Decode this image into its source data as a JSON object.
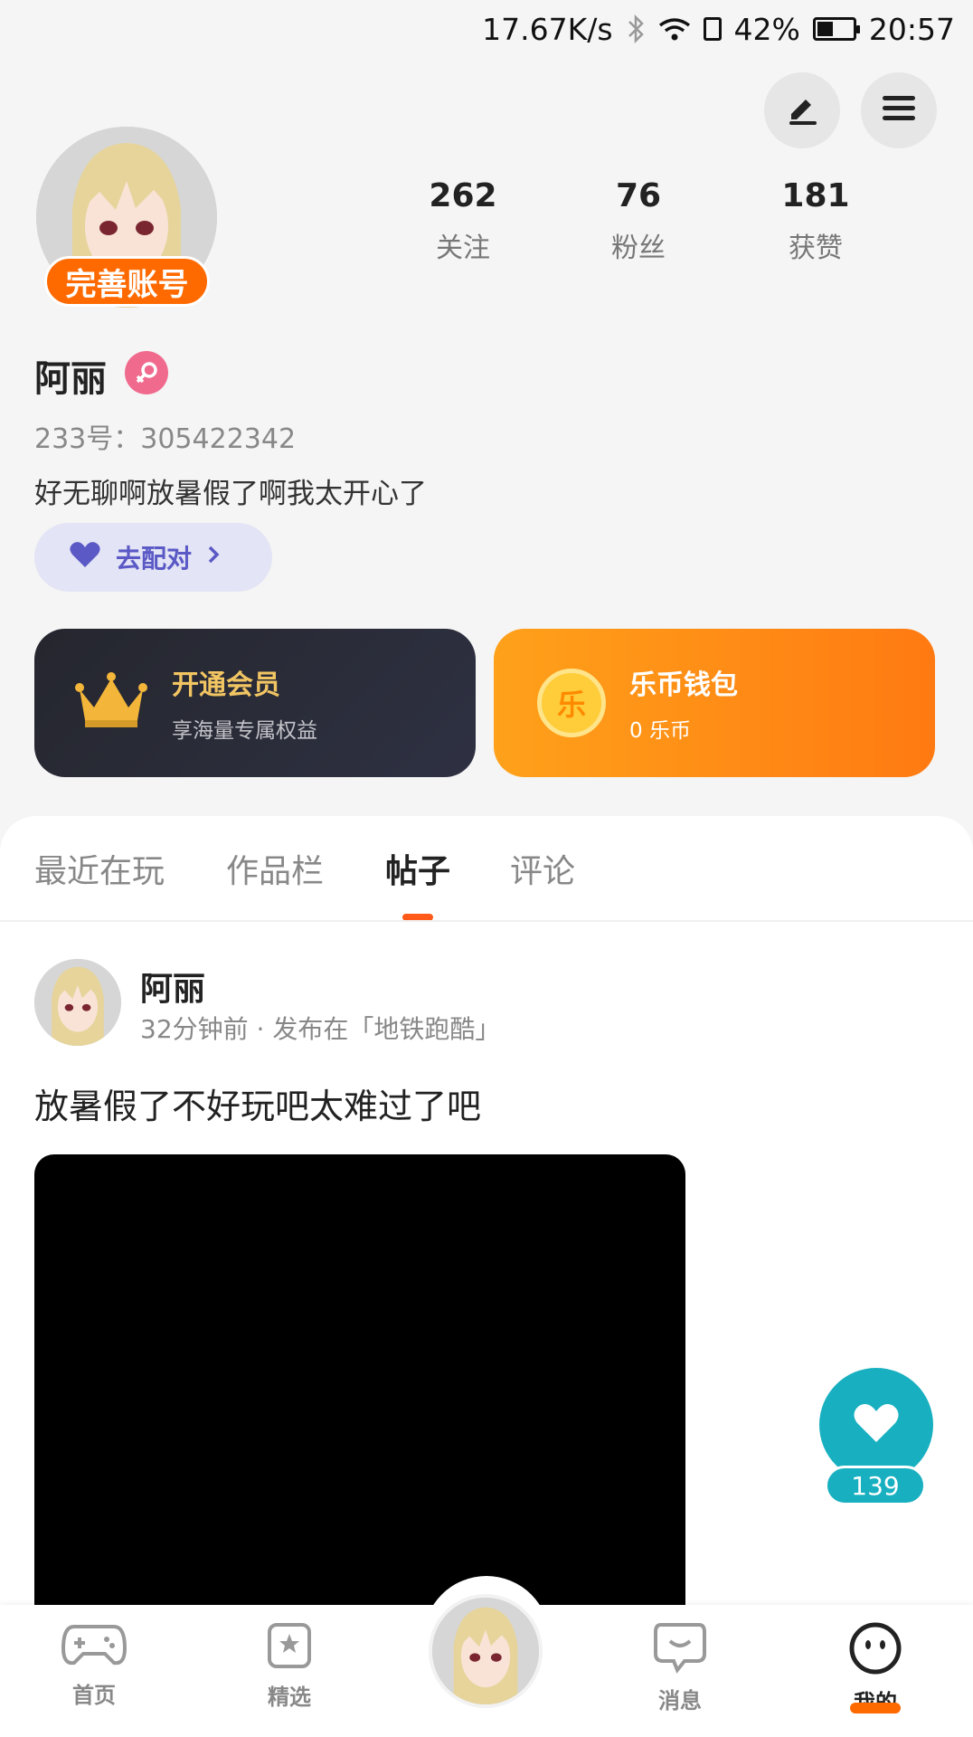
{
  "status_bar": {
    "net_speed": "17.67K/s",
    "battery": "42%",
    "time": "20:57"
  },
  "profile": {
    "complete_badge": "完善账号",
    "stats": [
      {
        "num": "262",
        "label": "关注"
      },
      {
        "num": "76",
        "label": "粉丝"
      },
      {
        "num": "181",
        "label": "获赞"
      }
    ],
    "name": "阿丽",
    "uid": "233号：305422342",
    "bio": "好无聊啊放暑假了啊我太开心了",
    "match_label": "去配对"
  },
  "cards": {
    "vip": {
      "title": "开通会员",
      "sub": "享海量专属权益"
    },
    "coin": {
      "title": "乐币钱包",
      "sub": "0 乐币",
      "coin_glyph": "乐"
    }
  },
  "tabs": [
    "最近在玩",
    "作品栏",
    "帖子",
    "评论"
  ],
  "post": {
    "author": "阿丽",
    "meta": "32分钟前 · 发布在「地铁跑酷」",
    "text": "放暑假了不好玩吧太难过了吧"
  },
  "like_count": "139",
  "bottom_nav": [
    "首页",
    "精选",
    "消息",
    "我的"
  ],
  "colors": {
    "accent": "#ff6a00",
    "match": "#5a59c6",
    "like": "#18b0c0",
    "gender": "#f06a8e"
  }
}
